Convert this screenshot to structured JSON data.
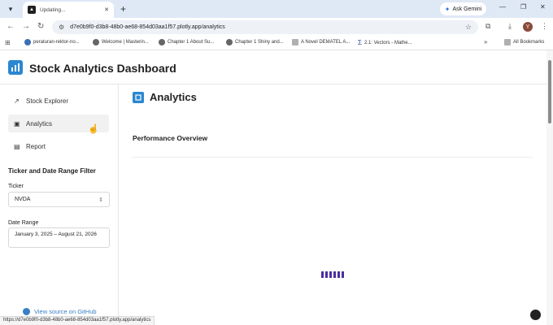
{
  "browser": {
    "tab_title": "Updating...",
    "gemini_label": "Ask Gemini",
    "url": "d7e0b9f0-d3b8-48b0-ae68-854d03aa1f57.plotly.app/analytics",
    "bookmarks": [
      "peraturan-rektor-no...",
      "Welcome | Masterin...",
      "Chapter 1 About Su...",
      "Chapter 1 Shiny and...",
      "A Novel DEMATEL A...",
      "2.1: Vectors - Mathe..."
    ],
    "all_bookmarks": "All Bookmarks",
    "avatar_letter": "Y",
    "status_url": "https://d7e0b9f0-d3b8-48b0-ae68-854d03aa1f57.plotly.app/analytics"
  },
  "app": {
    "title": "Stock Analytics Dashboard",
    "accent": "#2b87d1"
  },
  "sidebar": {
    "nav": [
      {
        "label": "Stock Explorer",
        "icon": "line-chart-icon",
        "active": false
      },
      {
        "label": "Analytics",
        "icon": "analytics-icon",
        "active": true
      },
      {
        "label": "Report",
        "icon": "report-icon",
        "active": false
      }
    ],
    "filter_title": "Ticker and Date Range Filter",
    "ticker_label": "Ticker",
    "ticker_value": "NVDA",
    "date_label": "Date Range",
    "date_value": "January 3, 2025 – August 21, 2026",
    "github_link": "View source on GitHub"
  },
  "main": {
    "title": "Analytics",
    "section": "Performance Overview",
    "loader_color": "#4b2fa0"
  }
}
